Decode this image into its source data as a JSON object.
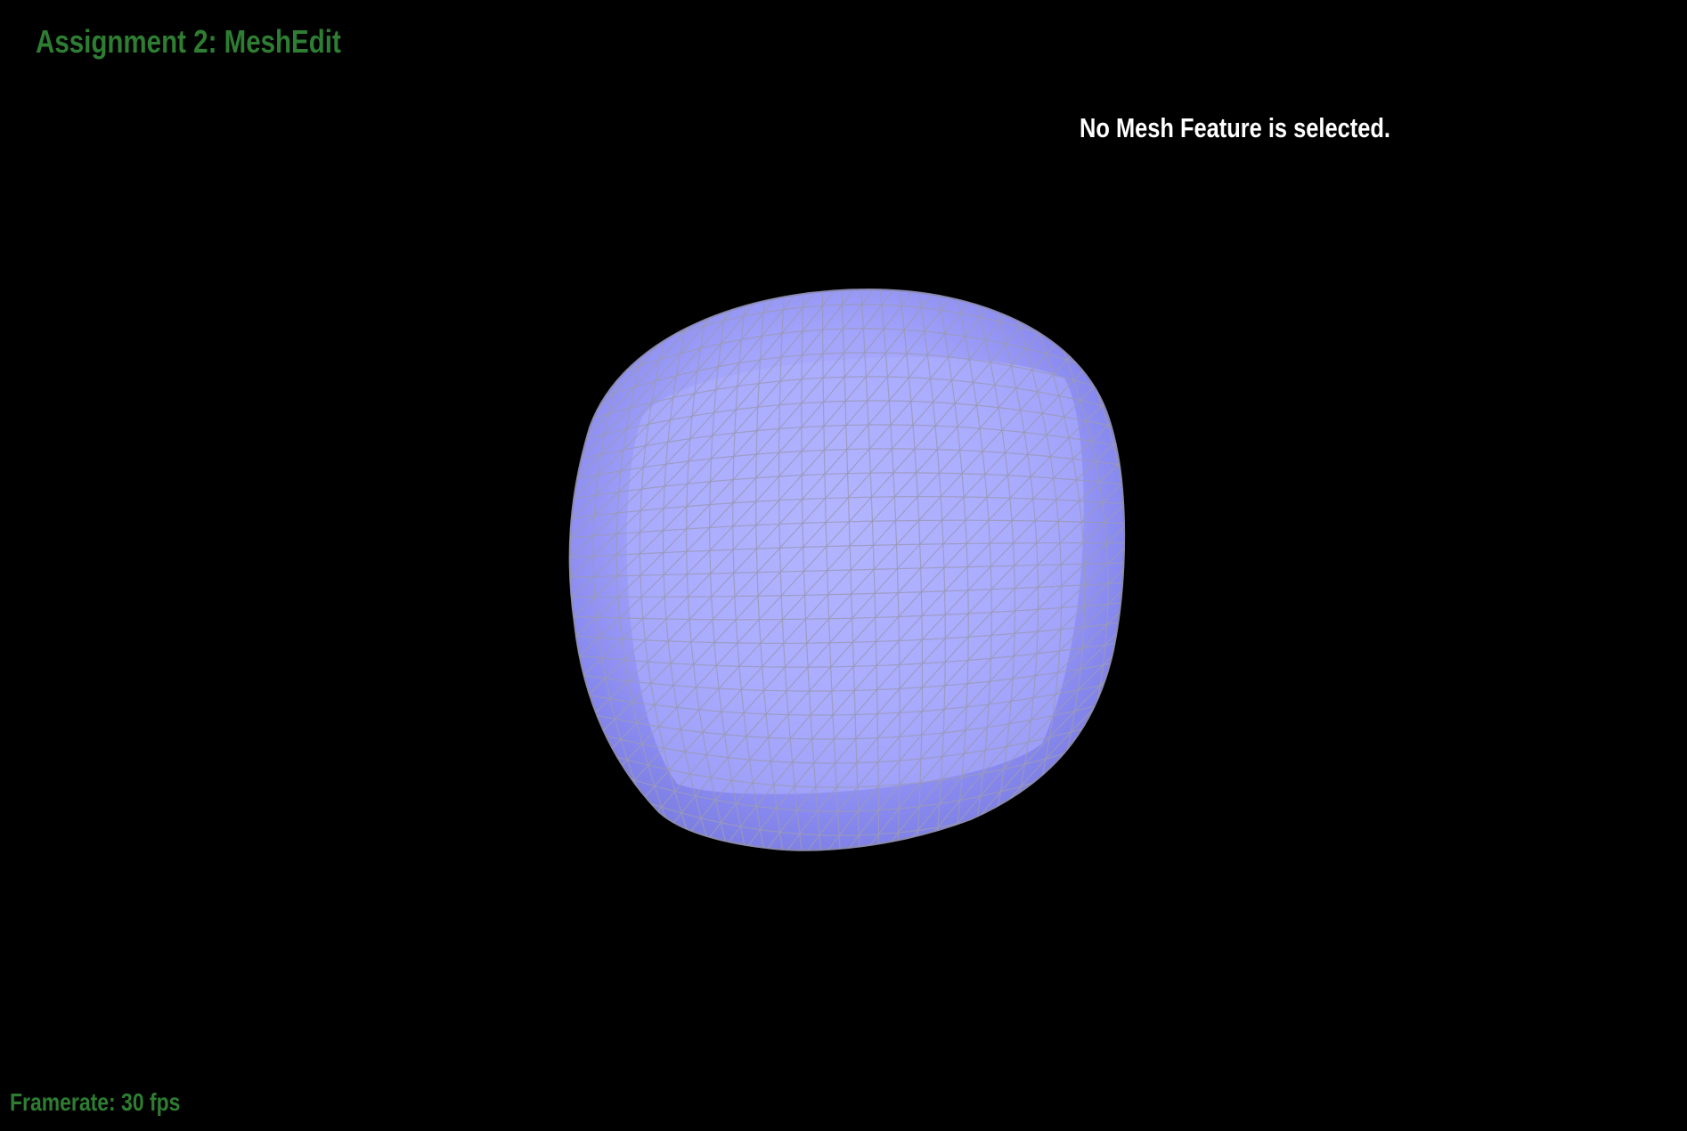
{
  "app": {
    "title": "Assignment 2: MeshEdit"
  },
  "status": {
    "selection_message": "No Mesh Feature is selected."
  },
  "footer": {
    "framerate_label": "Framerate: 30 fps"
  },
  "colors": {
    "background": "#000000",
    "title_green": "#2e7d32",
    "status_white": "#ffffff",
    "mesh_fill": "#8f90f5",
    "mesh_wire": "#9a9ab8"
  }
}
